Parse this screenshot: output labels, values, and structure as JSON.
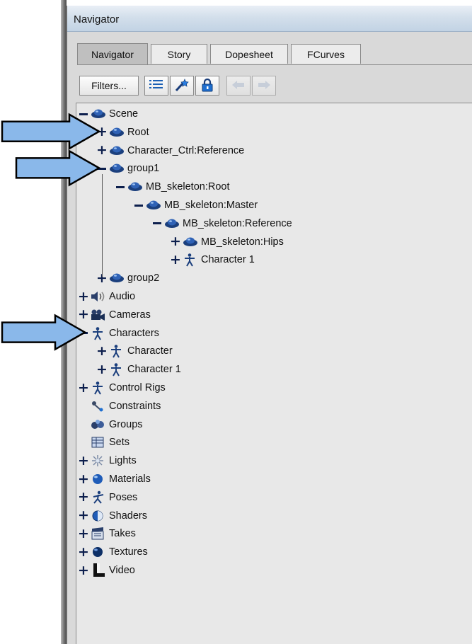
{
  "window": {
    "title": "Navigator"
  },
  "tabs": [
    {
      "label": "Navigator",
      "active": true
    },
    {
      "label": "Story",
      "active": false
    },
    {
      "label": "Dopesheet",
      "active": false
    },
    {
      "label": "FCurves",
      "active": false
    }
  ],
  "toolbar": {
    "filters_label": "Filters...",
    "buttons": [
      "list-view-icon",
      "magic-wand-icon",
      "lock-icon",
      "arrow-left-icon",
      "arrow-right-icon"
    ]
  },
  "tree": [
    {
      "label": "Scene",
      "icon": "scene-icon",
      "toggle": "minus",
      "depth": 0
    },
    {
      "label": "Root",
      "icon": "model-icon",
      "toggle": "plus",
      "depth": 1
    },
    {
      "label": "Character_Ctrl:Reference",
      "icon": "model-icon",
      "toggle": "plus",
      "depth": 1
    },
    {
      "label": "group1",
      "icon": "model-icon",
      "toggle": "minus",
      "depth": 1
    },
    {
      "label": "MB_skeleton:Root",
      "icon": "model-icon",
      "toggle": "minus",
      "depth": 2
    },
    {
      "label": "MB_skeleton:Master",
      "icon": "model-icon",
      "toggle": "minus",
      "depth": 3
    },
    {
      "label": "MB_skeleton:Reference",
      "icon": "model-icon",
      "toggle": "minus",
      "depth": 4
    },
    {
      "label": "MB_skeleton:Hips",
      "icon": "model-icon",
      "toggle": "plus",
      "depth": 5
    },
    {
      "label": "Character 1",
      "icon": "character-icon",
      "toggle": "plus",
      "depth": 5
    },
    {
      "label": "group2",
      "icon": "model-icon",
      "toggle": "plus",
      "depth": 1
    },
    {
      "label": "Audio",
      "icon": "audio-icon",
      "toggle": "plus",
      "depth": 0
    },
    {
      "label": "Cameras",
      "icon": "camera-icon",
      "toggle": "plus",
      "depth": 0
    },
    {
      "label": "Characters",
      "icon": "character-icon",
      "toggle": "minus",
      "depth": 0
    },
    {
      "label": "Character",
      "icon": "character-icon",
      "toggle": "plus",
      "depth": 1
    },
    {
      "label": "Character 1",
      "icon": "character-icon",
      "toggle": "plus",
      "depth": 1
    },
    {
      "label": "Control Rigs",
      "icon": "character-icon",
      "toggle": "plus",
      "depth": 0
    },
    {
      "label": "Constraints",
      "icon": "constraint-icon",
      "toggle": "none",
      "depth": 0
    },
    {
      "label": "Groups",
      "icon": "groups-icon",
      "toggle": "none",
      "depth": 0
    },
    {
      "label": "Sets",
      "icon": "sets-icon",
      "toggle": "none",
      "depth": 0
    },
    {
      "label": "Lights",
      "icon": "light-icon",
      "toggle": "plus",
      "depth": 0
    },
    {
      "label": "Materials",
      "icon": "material-icon",
      "toggle": "plus",
      "depth": 0
    },
    {
      "label": "Poses",
      "icon": "pose-icon",
      "toggle": "plus",
      "depth": 0
    },
    {
      "label": "Shaders",
      "icon": "shader-icon",
      "toggle": "plus",
      "depth": 0
    },
    {
      "label": "Takes",
      "icon": "take-icon",
      "toggle": "plus",
      "depth": 0
    },
    {
      "label": "Textures",
      "icon": "texture-icon",
      "toggle": "plus",
      "depth": 0
    },
    {
      "label": "Video",
      "icon": "video-icon",
      "toggle": "plus",
      "depth": 0
    }
  ],
  "callout_arrows": [
    {
      "target": "Root"
    },
    {
      "target": "group1"
    },
    {
      "target": "Characters"
    }
  ],
  "colors": {
    "arrow_fill": "#8ab8ea",
    "arrow_stroke": "#000000",
    "toggle": "#0d1f4d"
  }
}
